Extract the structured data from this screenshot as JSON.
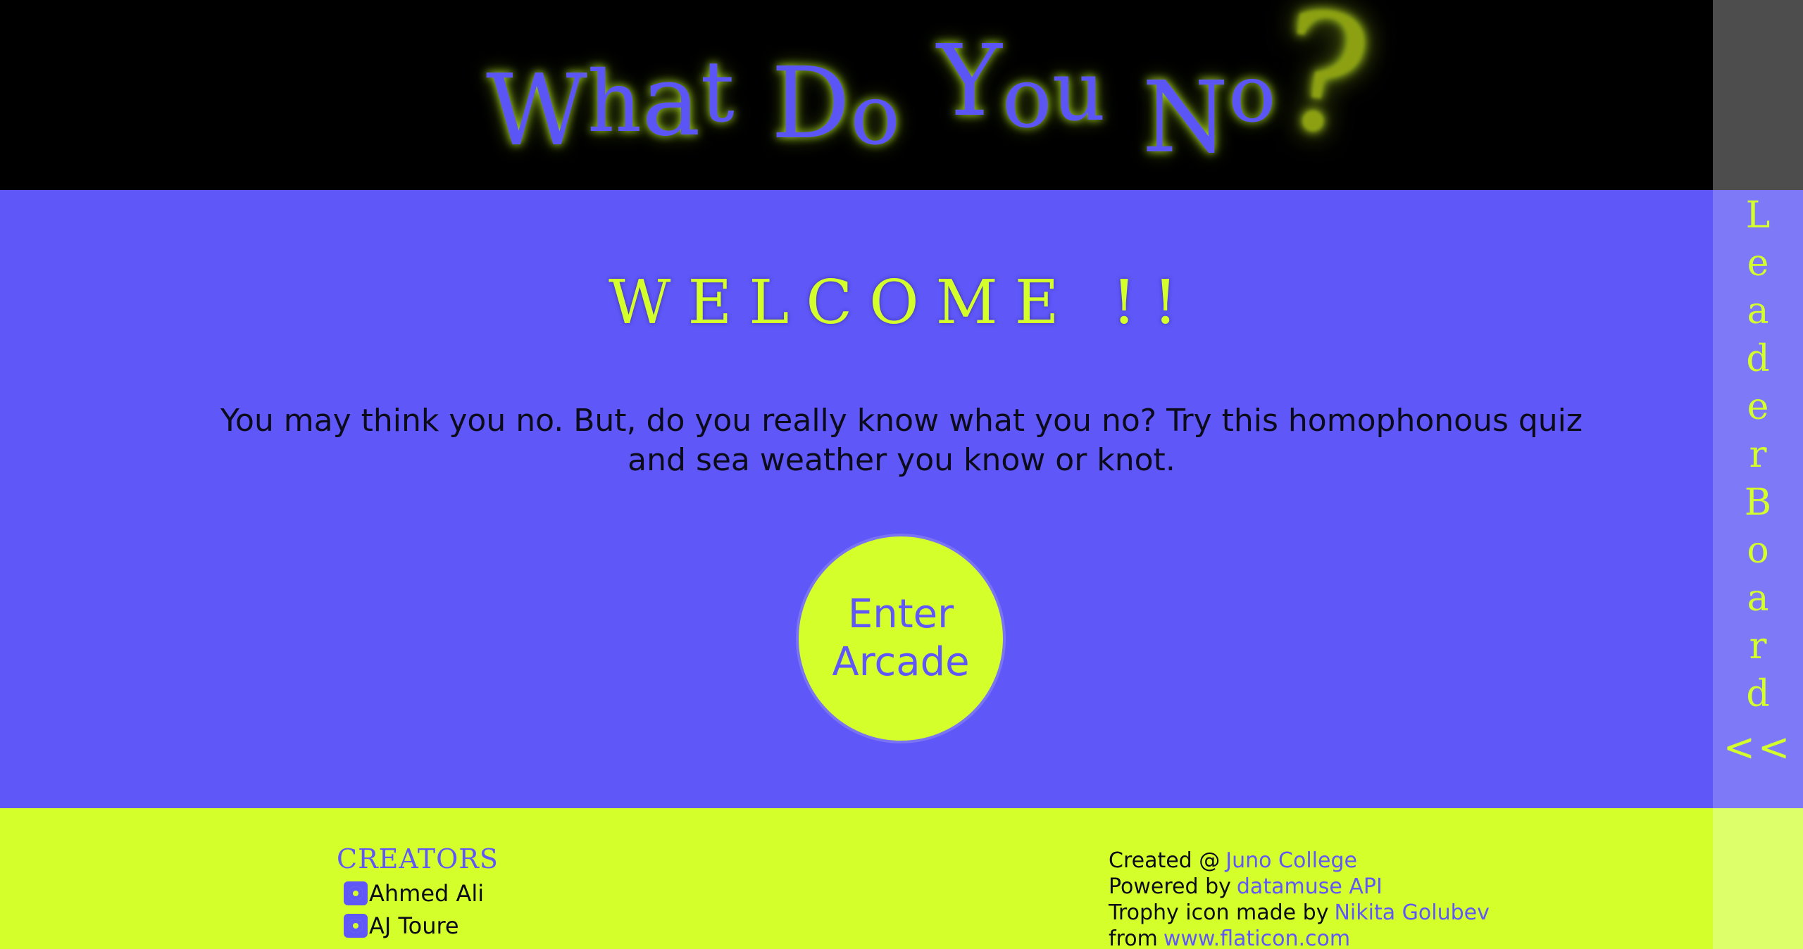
{
  "header": {
    "title_letters": [
      "W",
      "h",
      "a",
      "t",
      " ",
      "D",
      "o",
      " ",
      "Y",
      "o",
      "u",
      " ",
      "N",
      "o"
    ],
    "title_qmark": "?"
  },
  "main": {
    "welcome_text": "WELCOME !!",
    "intro": "You may think you no. But, do you really know what you no? Try this homophonous quiz and sea weather you know or knot.",
    "enter_button": {
      "line1": "Enter",
      "line2": "Arcade"
    }
  },
  "leaderboard": {
    "label_letters": [
      "L",
      "e",
      "a",
      "d",
      "e",
      "r",
      "B",
      "o",
      "a",
      "r",
      "d"
    ],
    "toggle": "<<"
  },
  "footer": {
    "creators_title": "CREATORS",
    "creators": [
      {
        "name": "Ahmed Ali"
      },
      {
        "name": "AJ Toure"
      }
    ],
    "credits": [
      {
        "prefix": "Created @",
        "link": "Juno College"
      },
      {
        "prefix": "Powered by",
        "link": "datamuse API"
      },
      {
        "prefix": "Trophy icon made by",
        "link": "Nikita Golubev"
      },
      {
        "prefix": "from",
        "link": "www.flaticon.com"
      }
    ]
  },
  "colors": {
    "primary": "#5f57f8",
    "accent": "#d4ff2b",
    "header_bg": "#000000",
    "leaderboard_bar": "#7e79f6"
  }
}
